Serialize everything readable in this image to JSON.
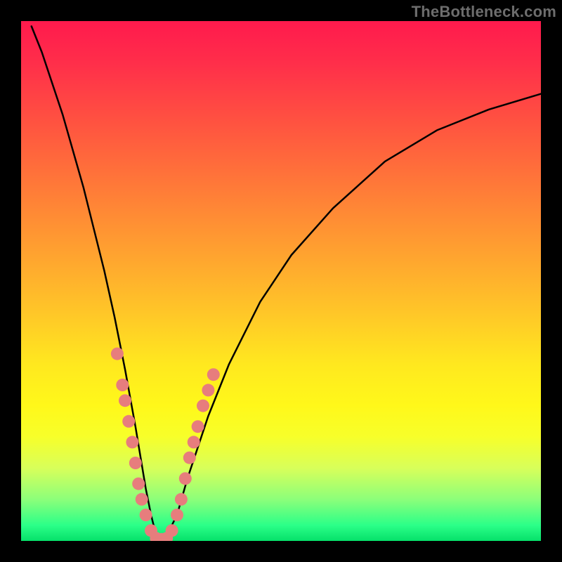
{
  "watermark": "TheBottleneck.com",
  "chart_data": {
    "type": "line",
    "title": "",
    "xlabel": "",
    "ylabel": "",
    "xlim": [
      0,
      100
    ],
    "ylim": [
      0,
      100
    ],
    "grid": false,
    "legend": false,
    "series": [
      {
        "name": "bottleneck-curve",
        "x": [
          2,
          4,
          6,
          8,
          10,
          12,
          14,
          16,
          18,
          20,
          22,
          23,
          24,
          25,
          26,
          27,
          28,
          30,
          32,
          36,
          40,
          46,
          52,
          60,
          70,
          80,
          90,
          100
        ],
        "values": [
          99,
          94,
          88,
          82,
          75,
          68,
          60,
          52,
          43,
          33,
          22,
          16,
          10,
          5,
          1,
          0,
          1,
          5,
          12,
          24,
          34,
          46,
          55,
          64,
          73,
          79,
          83,
          86
        ]
      }
    ],
    "markers": {
      "name": "highlight-dots",
      "color": "#e77d7d",
      "points": [
        {
          "x": 18.5,
          "y": 36
        },
        {
          "x": 19.5,
          "y": 30
        },
        {
          "x": 20.0,
          "y": 27
        },
        {
          "x": 20.7,
          "y": 23
        },
        {
          "x": 21.4,
          "y": 19
        },
        {
          "x": 22.0,
          "y": 15
        },
        {
          "x": 22.6,
          "y": 11
        },
        {
          "x": 23.2,
          "y": 8
        },
        {
          "x": 24.0,
          "y": 5
        },
        {
          "x": 25.0,
          "y": 2
        },
        {
          "x": 26.0,
          "y": 0.5
        },
        {
          "x": 27.0,
          "y": 0.3
        },
        {
          "x": 28.0,
          "y": 0.5
        },
        {
          "x": 29.0,
          "y": 2
        },
        {
          "x": 30.0,
          "y": 5
        },
        {
          "x": 30.8,
          "y": 8
        },
        {
          "x": 31.6,
          "y": 12
        },
        {
          "x": 32.4,
          "y": 16
        },
        {
          "x": 33.2,
          "y": 19
        },
        {
          "x": 34.0,
          "y": 22
        },
        {
          "x": 35.0,
          "y": 26
        },
        {
          "x": 36.0,
          "y": 29
        },
        {
          "x": 37.0,
          "y": 32
        }
      ]
    },
    "gradient_bands": [
      {
        "value": 100,
        "color": "#ff1a4d"
      },
      {
        "value": 50,
        "color": "#ffc628"
      },
      {
        "value": 20,
        "color": "#fff81a"
      },
      {
        "value": 0,
        "color": "#06e06a"
      }
    ]
  }
}
